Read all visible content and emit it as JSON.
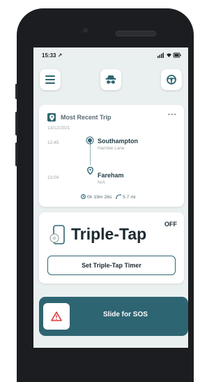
{
  "status_bar": {
    "time": "15:33 ↗"
  },
  "top_buttons": [
    {
      "icon": "menu-icon"
    },
    {
      "icon": "incognito-icon"
    },
    {
      "icon": "steering-wheel-icon"
    }
  ],
  "trip": {
    "title": "Most Recent Trip",
    "more": "···",
    "date": "13/12/2021",
    "start": {
      "time": "12:45",
      "name": "Southampton",
      "sub": "Hamble Lane"
    },
    "end": {
      "time": "13:04",
      "name": "Fareham",
      "sub": "N/A"
    },
    "duration": "0h 19m 26s",
    "distance": "5.7 mi"
  },
  "triple_tap": {
    "title": "Triple-Tap",
    "state": "OFF",
    "timer_button": "Set Triple-Tap Timer"
  },
  "sos": {
    "label": "Slide for SOS"
  },
  "colors": {
    "accent": "#2e6572",
    "background": "#eaf0ef",
    "warning": "#e03a3a"
  }
}
